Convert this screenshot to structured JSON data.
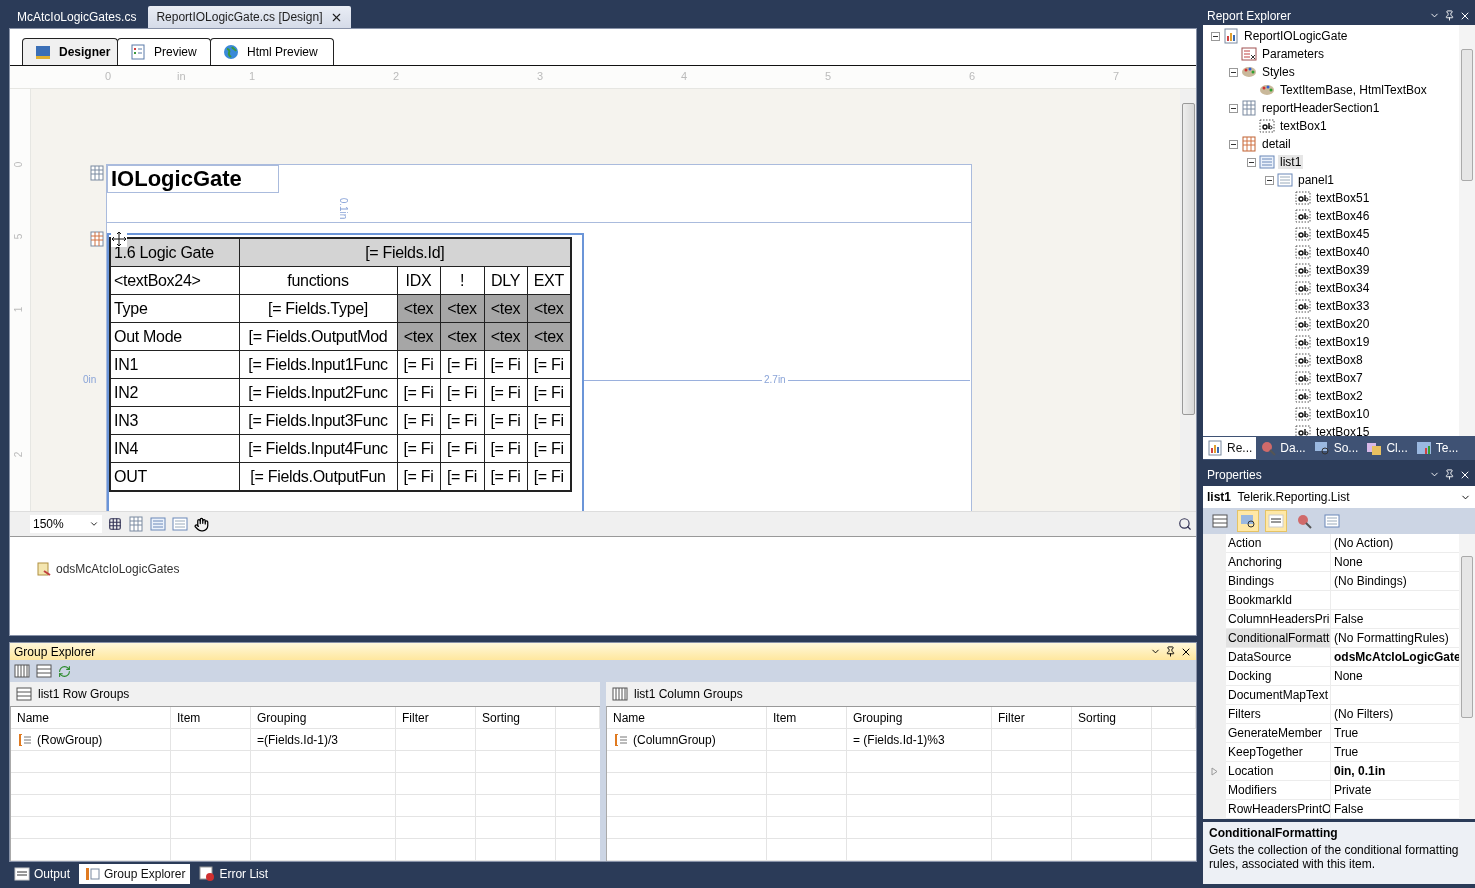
{
  "document_tabs": [
    {
      "label": "McAtcIoLogicGates.cs",
      "selected": false
    },
    {
      "label": "ReportIOLogicGate.cs [Design]",
      "selected": true
    }
  ],
  "designer_tabs": [
    {
      "label": "Designer",
      "selected": true
    },
    {
      "label": "Preview",
      "selected": false
    },
    {
      "label": "Html Preview",
      "selected": false
    }
  ],
  "ruler": {
    "marks": [
      "0",
      "in",
      "1",
      "2",
      "3",
      "4",
      "5",
      "6",
      "7"
    ],
    "vertical_marks": [
      "0",
      "5",
      "1",
      "2"
    ]
  },
  "report": {
    "title": "IOLogicGate",
    "guides": {
      "top": "0.1in",
      "left": "0in",
      "right": "2.7in"
    },
    "table": {
      "header": {
        "label": "1.6 Logic Gate",
        "field": "[= Fields.Id]"
      },
      "rows": [
        {
          "kind": "labels",
          "cells": [
            "<textBox24>",
            "functions",
            "IDX",
            "!",
            "DLY",
            "EXT"
          ]
        },
        {
          "kind": "template",
          "cells": [
            "Type",
            "[= Fields.Type]",
            "<tex",
            "<tex",
            "<tex",
            "<tex"
          ]
        },
        {
          "kind": "template",
          "cells": [
            "Out Mode",
            "[= Fields.OutputMod",
            "<tex",
            "<tex",
            "<tex",
            "<tex"
          ]
        },
        {
          "kind": "data",
          "cells": [
            "IN1",
            "[= Fields.Input1Func",
            "[= Fi",
            "[= Fi",
            "[= Fi",
            "[= Fi"
          ]
        },
        {
          "kind": "data",
          "cells": [
            "IN2",
            "[= Fields.Input2Func",
            "[= Fi",
            "[= Fi",
            "[= Fi",
            "[= Fi"
          ]
        },
        {
          "kind": "data",
          "cells": [
            "IN3",
            "[= Fields.Input3Func",
            "[= Fi",
            "[= Fi",
            "[= Fi",
            "[= Fi"
          ]
        },
        {
          "kind": "data",
          "cells": [
            "IN4",
            "[= Fields.Input4Func",
            "[= Fi",
            "[= Fi",
            "[= Fi",
            "[= Fi"
          ]
        },
        {
          "kind": "data",
          "cells": [
            "OUT",
            "[= Fields.OutputFun",
            "[= Fi",
            "[= Fi",
            "[= Fi",
            "[= Fi"
          ]
        }
      ]
    }
  },
  "zoom": "150%",
  "data_sources": [
    "odsMcAtcIoLogicGates"
  ],
  "group_explorer": {
    "title": "Group Explorer",
    "panes": [
      {
        "kind": "rows",
        "title": "list1 Row Groups",
        "columns": [
          "Name",
          "Item",
          "Grouping",
          "Filter",
          "Sorting"
        ],
        "groups": [
          {
            "name": "(RowGroup)",
            "grouping": "=(Fields.Id-1)/3"
          }
        ]
      },
      {
        "kind": "columns",
        "title": "list1 Column Groups",
        "columns": [
          "Name",
          "Item",
          "Grouping",
          "Filter",
          "Sorting"
        ],
        "groups": [
          {
            "name": "(ColumnGroup)",
            "grouping": "= (Fields.Id-1)%3"
          }
        ]
      }
    ]
  },
  "bottom_tabs": [
    {
      "label": "Output",
      "selected": false
    },
    {
      "label": "Group Explorer",
      "selected": true
    },
    {
      "label": "Error List",
      "selected": false
    }
  ],
  "report_explorer": {
    "title": "Report Explorer",
    "tree": [
      {
        "label": "ReportIOLogicGate",
        "kind": "report",
        "selected": false,
        "expanded": true,
        "children": [
          {
            "label": "Parameters",
            "kind": "parameters",
            "selected": false
          },
          {
            "label": "Styles",
            "kind": "styles",
            "selected": false,
            "expanded": true,
            "children": [
              {
                "label": "TextItemBase, HtmlTextBox",
                "kind": "style",
                "selected": false
              }
            ]
          },
          {
            "label": "reportHeaderSection1",
            "kind": "section",
            "selected": false,
            "expanded": true,
            "children": [
              {
                "label": "textBox1",
                "kind": "textbox",
                "selected": false
              }
            ]
          },
          {
            "label": "detail",
            "kind": "detail",
            "selected": false,
            "expanded": true,
            "children": [
              {
                "label": "list1",
                "kind": "list",
                "selected": true,
                "expanded": true,
                "children": [
                  {
                    "label": "panel1",
                    "kind": "panel",
                    "selected": false,
                    "expanded": true,
                    "children": [
                      {
                        "label": "textBox51",
                        "kind": "textbox",
                        "selected": false
                      },
                      {
                        "label": "textBox46",
                        "kind": "textbox",
                        "selected": false
                      },
                      {
                        "label": "textBox45",
                        "kind": "textbox",
                        "selected": false
                      },
                      {
                        "label": "textBox40",
                        "kind": "textbox",
                        "selected": false
                      },
                      {
                        "label": "textBox39",
                        "kind": "textbox",
                        "selected": false
                      },
                      {
                        "label": "textBox34",
                        "kind": "textbox",
                        "selected": false
                      },
                      {
                        "label": "textBox33",
                        "kind": "textbox",
                        "selected": false
                      },
                      {
                        "label": "textBox20",
                        "kind": "textbox",
                        "selected": false
                      },
                      {
                        "label": "textBox19",
                        "kind": "textbox",
                        "selected": false
                      },
                      {
                        "label": "textBox8",
                        "kind": "textbox",
                        "selected": false
                      },
                      {
                        "label": "textBox7",
                        "kind": "textbox",
                        "selected": false
                      },
                      {
                        "label": "textBox2",
                        "kind": "textbox",
                        "selected": false
                      },
                      {
                        "label": "textBox10",
                        "kind": "textbox",
                        "selected": false
                      },
                      {
                        "label": "textBox15",
                        "kind": "textbox",
                        "selected": false
                      }
                    ]
                  }
                ]
              }
            ]
          }
        ]
      }
    ],
    "tabs": [
      {
        "label": "Re...",
        "selected": true
      },
      {
        "label": "Da...",
        "selected": false
      },
      {
        "label": "So...",
        "selected": false
      },
      {
        "label": "Cl...",
        "selected": false
      },
      {
        "label": "Te...",
        "selected": false
      }
    ]
  },
  "properties": {
    "title": "Properties",
    "object_name": "list1",
    "object_type": "Telerik.Reporting.List",
    "rows": [
      {
        "name": "Action",
        "value": "(No Action)",
        "bold": false,
        "selected": false,
        "expandable": false
      },
      {
        "name": "Anchoring",
        "value": "None",
        "bold": false,
        "selected": false,
        "expandable": false
      },
      {
        "name": "Bindings",
        "value": "(No Bindings)",
        "bold": false,
        "selected": false,
        "expandable": false
      },
      {
        "name": "BookmarkId",
        "selected": false,
        "expandable": false
      },
      {
        "name": "ColumnHeadersPri",
        "value": "False",
        "bold": false,
        "selected": false,
        "expandable": false
      },
      {
        "name": "ConditionalFormatt",
        "value": "(No FormattingRules)",
        "bold": false,
        "selected": true,
        "expandable": false
      },
      {
        "name": "DataSource",
        "value": "odsMcAtcIoLogicGate",
        "bold": true,
        "selected": false,
        "expandable": false
      },
      {
        "name": "Docking",
        "value": "None",
        "bold": false,
        "selected": false,
        "expandable": false
      },
      {
        "name": "DocumentMapText",
        "selected": false,
        "expandable": false
      },
      {
        "name": "Filters",
        "value": "(No Filters)",
        "bold": false,
        "selected": false,
        "expandable": false
      },
      {
        "name": "GenerateMember",
        "value": "True",
        "bold": false,
        "selected": false,
        "expandable": false
      },
      {
        "name": "KeepTogether",
        "value": "True",
        "bold": false,
        "selected": false,
        "expandable": false
      },
      {
        "name": "Location",
        "value": "0in, 0.1in",
        "bold": true,
        "selected": false,
        "expandable": true
      },
      {
        "name": "Modifiers",
        "value": "Private",
        "bold": false,
        "selected": false,
        "expandable": false
      },
      {
        "name": "RowHeadersPrintO",
        "value": "False",
        "bold": false,
        "selected": false,
        "expandable": false
      }
    ],
    "description_title": "ConditionalFormatting",
    "description": "Gets the collection of the conditional formatting rules, associated with this item."
  }
}
